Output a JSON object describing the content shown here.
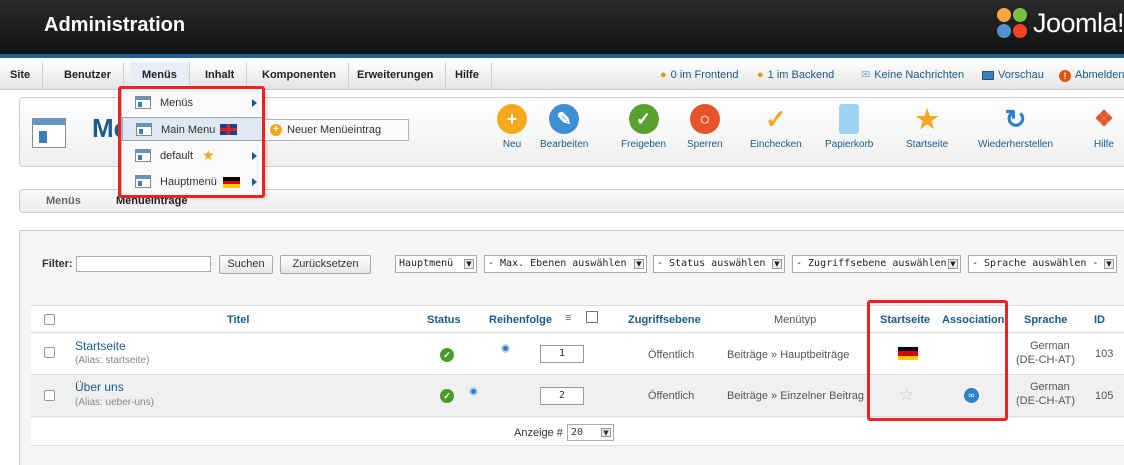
{
  "header": {
    "title": "Administration",
    "logo_text": "Joomla!"
  },
  "menubar": {
    "items": [
      "Site",
      "Benutzer",
      "Menüs",
      "Inhalt",
      "Komponenten",
      "Erweiterungen",
      "Hilfe"
    ],
    "status": {
      "frontend": "0 im Frontend",
      "backend": "1 im Backend",
      "messages": "Keine Nachrichten",
      "preview": "Vorschau",
      "logout": "Abmelden"
    }
  },
  "page": {
    "title": "Menüeinträge",
    "visible_title": "Mer"
  },
  "toolbar": {
    "buttons": [
      "Neu",
      "Bearbeiten",
      "Freigeben",
      "Sperren",
      "Einchecken",
      "Papierkorb",
      "Startseite",
      "Wiederherstellen",
      "Hilfe"
    ]
  },
  "subtabs": {
    "tab1": "Menüs",
    "tab2": "Menüeinträge"
  },
  "dropdown": {
    "items": [
      {
        "label": "Menüs"
      },
      {
        "label": "Main Menu"
      },
      {
        "label": "default"
      },
      {
        "label": "Hauptmenü"
      }
    ],
    "submenu_label": "Neuer Menüeintrag"
  },
  "filter": {
    "label": "Filter:",
    "value": "",
    "search_button": "Suchen",
    "reset_button": "Zurücksetzen",
    "menu_select": "Hauptmenü",
    "levels_select": "- Max. Ebenen auswählen -",
    "status_select": "- Status auswählen -",
    "access_select": "- Zugriffsebene auswählen -",
    "language_select": "- Sprache auswählen -"
  },
  "table": {
    "columns": [
      "Titel",
      "Status",
      "Reihenfolge",
      "Zugriffsebene",
      "Menütyp",
      "Startseite",
      "Association",
      "Sprache",
      "ID"
    ],
    "rows": [
      {
        "title": "Startseite",
        "alias": "(Alias: startseite)",
        "order": "1",
        "access": "Öffentlich",
        "type": "Beiträge » Hauptbeiträge",
        "lang1": "German",
        "lang2": "(DE-CH-AT)",
        "id": "103"
      },
      {
        "title": "Über uns",
        "alias": "(Alias: ueber-uns)",
        "order": "2",
        "access": "Öffentlich",
        "type": "Beiträge » Einzelner Beitrag",
        "lang1": "German",
        "lang2": "(DE-CH-AT)",
        "id": "105"
      }
    ]
  },
  "pagination": {
    "label": "Anzeige #",
    "value": "20"
  },
  "colors": {
    "brand_blue": "#1a5b8c",
    "header_bg": "#1a1a1a",
    "highlight_red": "#e22222"
  }
}
